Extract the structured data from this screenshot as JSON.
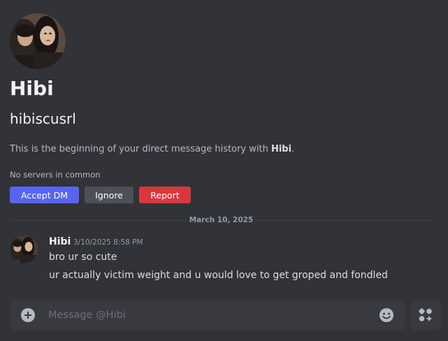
{
  "profile": {
    "display_name": "Hibi",
    "username": "hibiscusrl",
    "intro_prefix": "This is the beginning of your direct message history with ",
    "intro_name": "Hibi",
    "intro_suffix": ".",
    "mutual_servers": "No servers in common"
  },
  "actions": {
    "accept_label": "Accept DM",
    "ignore_label": "Ignore",
    "report_label": "Report"
  },
  "divider": {
    "date": "March 10, 2025"
  },
  "message": {
    "author": "Hibi",
    "timestamp": "3/10/2025 8:58 PM",
    "lines": [
      "bro ur so cute",
      "ur actually victim weight and u would love to get groped and fondled"
    ]
  },
  "composer": {
    "placeholder": "Message @Hibi",
    "value": ""
  },
  "colors": {
    "background": "#313338",
    "accept": "#5865f2",
    "ignore": "#4e5058",
    "report": "#da373c",
    "composer": "#383a40"
  },
  "icons": {
    "attach": "plus-circle-icon",
    "emoji": "smiley-icon",
    "apps": "app-launcher-icon"
  }
}
